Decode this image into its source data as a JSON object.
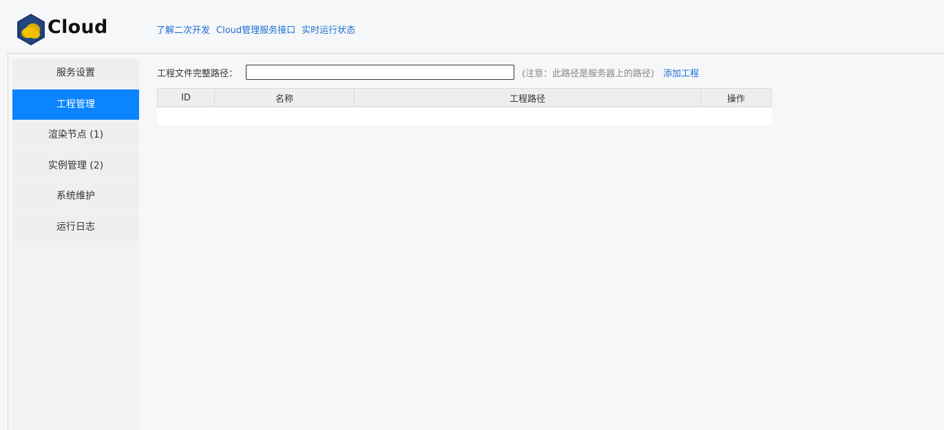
{
  "header": {
    "brand": "Cloud",
    "nav": [
      {
        "label": "了解二次开发"
      },
      {
        "label": "Cloud管理服务接口"
      },
      {
        "label": "实时运行状态"
      }
    ]
  },
  "sidebar": {
    "items": [
      {
        "label": "服务设置",
        "active": false
      },
      {
        "label": "工程管理",
        "active": true
      },
      {
        "label": "渲染节点 (1)",
        "active": false
      },
      {
        "label": "实例管理 (2)",
        "active": false
      },
      {
        "label": "系统维护",
        "active": false
      },
      {
        "label": "运行日志",
        "active": false
      }
    ]
  },
  "main": {
    "path_label": "工程文件完整路径：",
    "path_value": "",
    "path_note": "(注意：此路径是服务器上的路径)",
    "add_label": "添加工程",
    "table": {
      "columns": [
        "ID",
        "名称",
        "工程路径",
        "操作"
      ],
      "rows": []
    }
  },
  "colors": {
    "accent": "#0a84ff",
    "link": "#1a6fd1",
    "logo_hex": "#1f3a6b",
    "logo_cloud": "#f5c400"
  }
}
